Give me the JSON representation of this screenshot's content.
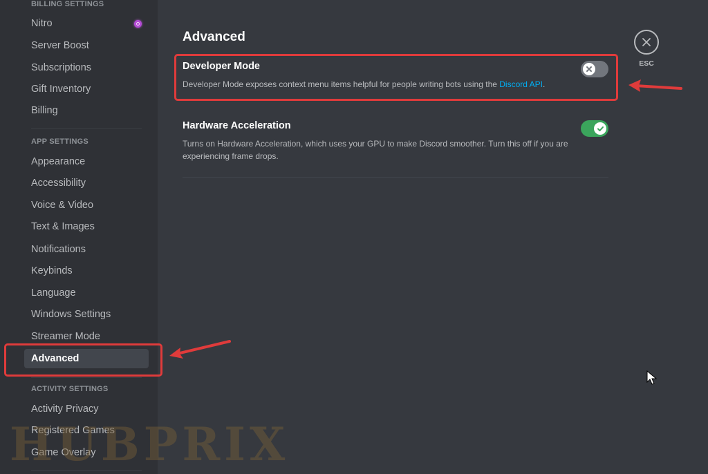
{
  "sidebar": {
    "sections": [
      {
        "header": "Billing Settings",
        "items": [
          {
            "label": "Nitro",
            "icon": "nitro-icon"
          },
          {
            "label": "Server Boost"
          },
          {
            "label": "Subscriptions"
          },
          {
            "label": "Gift Inventory"
          },
          {
            "label": "Billing"
          }
        ]
      },
      {
        "header": "App Settings",
        "items": [
          {
            "label": "Appearance"
          },
          {
            "label": "Accessibility"
          },
          {
            "label": "Voice & Video"
          },
          {
            "label": "Text & Images"
          },
          {
            "label": "Notifications"
          },
          {
            "label": "Keybinds"
          },
          {
            "label": "Language"
          },
          {
            "label": "Windows Settings"
          },
          {
            "label": "Streamer Mode"
          },
          {
            "label": "Advanced",
            "selected": true
          }
        ]
      },
      {
        "header": "Activity Settings",
        "items": [
          {
            "label": "Activity Privacy"
          },
          {
            "label": "Registered Games"
          },
          {
            "label": "Game Overlay"
          }
        ]
      }
    ]
  },
  "main": {
    "title": "Advanced",
    "settings": [
      {
        "title": "Developer Mode",
        "description_prefix": "Developer Mode exposes context menu items helpful for people writing bots using the ",
        "link_text": "Discord API",
        "description_suffix": ".",
        "enabled": false
      },
      {
        "title": "Hardware Acceleration",
        "description": "Turns on Hardware Acceleration, which uses your GPU to make Discord smoother. Turn this off if you are experiencing frame drops.",
        "enabled": true
      }
    ]
  },
  "close": {
    "label": "ESC",
    "icon": "close-icon"
  },
  "watermark": "HUBPRIX",
  "colors": {
    "background": "#36393f",
    "sidebar": "#2f3136",
    "toggle_on": "#3ba55c",
    "toggle_off": "#72767d",
    "link": "#00aff4",
    "annotation": "#e03b3b"
  }
}
